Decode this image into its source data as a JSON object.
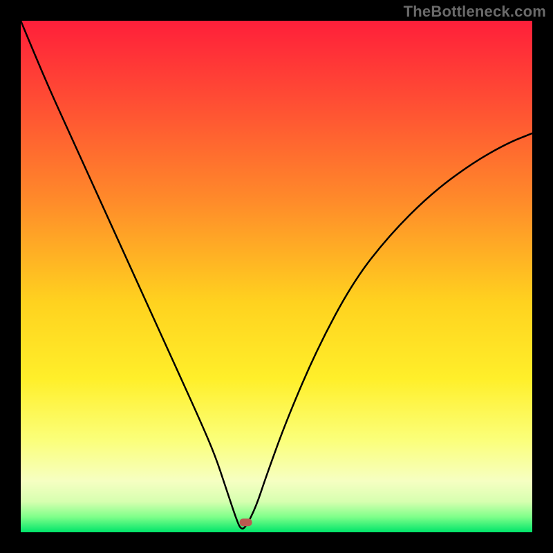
{
  "watermark": "TheBottleneck.com",
  "chart_data": {
    "type": "line",
    "title": "",
    "xlabel": "",
    "ylabel": "",
    "xlim": [
      0,
      100
    ],
    "ylim": [
      0,
      100
    ],
    "minimum_x": 43,
    "marker": {
      "x": 44,
      "y": 2,
      "color": "#bb5a50"
    },
    "gradient_stops": [
      {
        "offset": 0.0,
        "color": "#ff1f3a"
      },
      {
        "offset": 0.15,
        "color": "#ff4b34"
      },
      {
        "offset": 0.35,
        "color": "#ff8a2a"
      },
      {
        "offset": 0.55,
        "color": "#ffd21f"
      },
      {
        "offset": 0.7,
        "color": "#ffef2a"
      },
      {
        "offset": 0.82,
        "color": "#fbff7a"
      },
      {
        "offset": 0.9,
        "color": "#f6ffc2"
      },
      {
        "offset": 0.94,
        "color": "#d7ffb0"
      },
      {
        "offset": 0.97,
        "color": "#7fff8a"
      },
      {
        "offset": 1.0,
        "color": "#00e56a"
      }
    ],
    "series": [
      {
        "name": "bottleneck-curve",
        "x": [
          0,
          5,
          10,
          15,
          20,
          25,
          30,
          35,
          38,
          40,
          41,
          42,
          43,
          44,
          46,
          48,
          52,
          58,
          65,
          72,
          80,
          88,
          95,
          100
        ],
        "y": [
          100,
          88,
          77,
          66,
          55,
          44,
          33,
          22,
          15,
          9,
          6,
          3,
          0.5,
          1,
          5,
          11,
          22,
          36,
          49,
          58,
          66,
          72,
          76,
          78
        ]
      }
    ]
  }
}
